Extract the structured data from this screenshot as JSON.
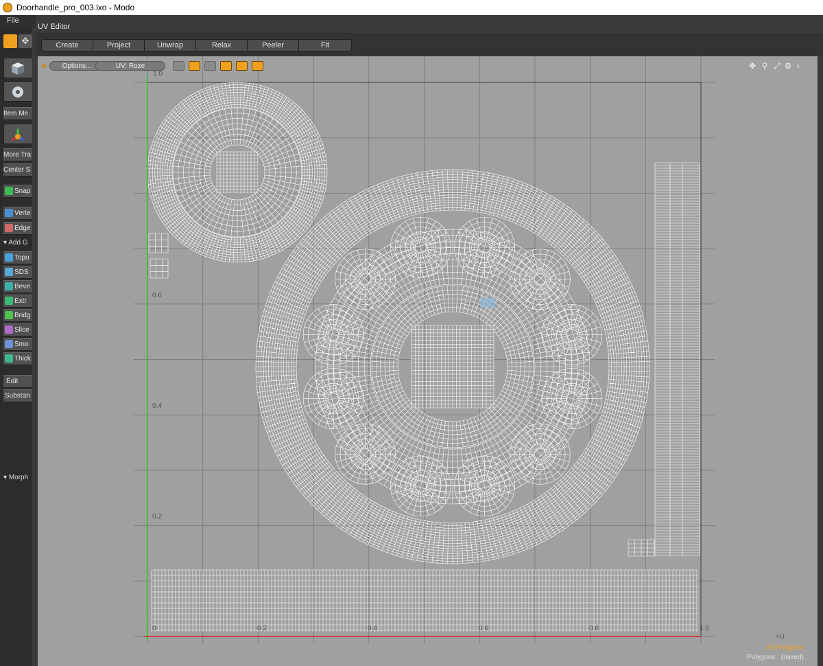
{
  "window": {
    "title": "Doorhandle_pro_003.lxo - Modo"
  },
  "menu": {
    "file": "File"
  },
  "panel": {
    "title": "UV Editor"
  },
  "toolbar": {
    "tabs": [
      {
        "label": "Create"
      },
      {
        "label": "Project"
      },
      {
        "label": "Unwrap"
      },
      {
        "label": "Relax"
      },
      {
        "label": "Peeler"
      },
      {
        "label": "Fit"
      }
    ]
  },
  "viewport": {
    "options_label": "Options...",
    "uv_map_label": "UV: Roze",
    "v_labels": [
      "1.0",
      "0.6",
      "0.4",
      "0.2"
    ],
    "u_labels": [
      "0",
      "0.2",
      "0.4",
      "0.6",
      "0.8",
      "1.0"
    ],
    "axis_u": "+U",
    "selection_mode": "All Polygons",
    "polygon_info": "Polygons : (mixed)"
  },
  "left_panel": {
    "items": [
      {
        "label": "Item Me"
      },
      {
        "label": "More Tra"
      },
      {
        "label": "Center S"
      },
      {
        "label": "Snap"
      },
      {
        "label": "Verte"
      },
      {
        "label": "Edge"
      },
      {
        "label": "Add G"
      },
      {
        "label": "Topo"
      },
      {
        "label": "SDS"
      },
      {
        "label": "Beve"
      },
      {
        "label": "Extr"
      },
      {
        "label": "Bridg"
      },
      {
        "label": "Slice"
      },
      {
        "label": "Smo"
      },
      {
        "label": "Thick"
      },
      {
        "label": "Edit"
      },
      {
        "label": "Substan"
      },
      {
        "label": "Morph"
      }
    ]
  },
  "colors": {
    "accent": "#f0a020",
    "viewport_bg": "#a0a0a0",
    "wire": "#ffffff",
    "v_axis": "#22cc22",
    "u_axis": "#dd2222"
  }
}
